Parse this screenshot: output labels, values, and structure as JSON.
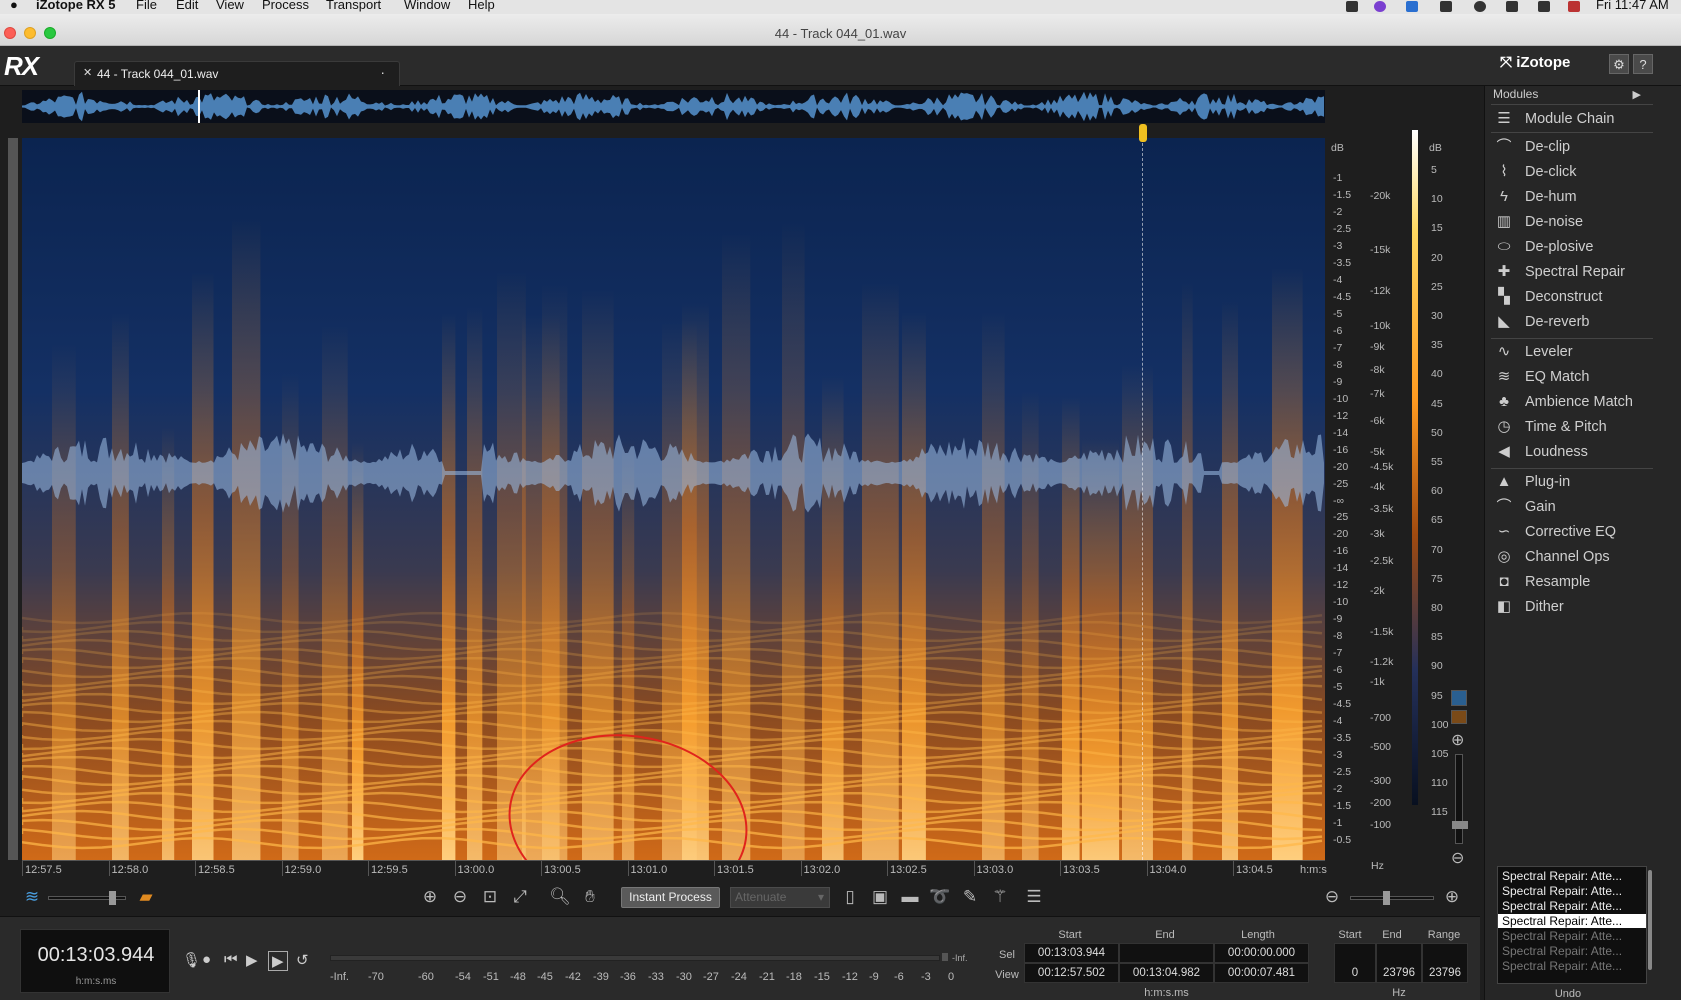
{
  "menubar": {
    "app_name": "iZotope RX 5",
    "items": [
      "File",
      "Edit",
      "View",
      "Process",
      "Transport",
      "Window",
      "Help"
    ],
    "clock": "Fri 11:47 AM"
  },
  "window": {
    "title": "44 - Track 044_01.wav"
  },
  "header": {
    "logo": "RX",
    "file_tab": "44 - Track 044_01.wav",
    "brand": "iZotope",
    "gear_label": "⚙",
    "help_label": "?"
  },
  "modules": {
    "header": "Modules",
    "chain": "Module Chain",
    "repair": [
      "De-clip",
      "De-click",
      "De-hum",
      "De-noise",
      "De-plosive",
      "Spectral Repair",
      "Deconstruct",
      "De-reverb"
    ],
    "mix": [
      "Leveler",
      "EQ Match",
      "Ambience Match",
      "Time & Pitch",
      "Loudness"
    ],
    "utility": [
      "Plug-in",
      "Gain",
      "Corrective EQ",
      "Channel Ops",
      "Resample",
      "Dither"
    ]
  },
  "time_axis": {
    "labels": [
      "12:57.5",
      "12:58.0",
      "12:58.5",
      "12:59.0",
      "12:59.5",
      "13:00.0",
      "13:00.5",
      "13:01.0",
      "13:01.5",
      "13:02.0",
      "13:02.5",
      "13:03.0",
      "13:03.5",
      "13:04.0",
      "13:04.5"
    ],
    "unit": "h:m:s"
  },
  "db_scale": {
    "unit": "dB",
    "top_labels": [
      "-1",
      "-1.5",
      "-2",
      "-2.5",
      "-3",
      "-3.5",
      "-4",
      "-4.5",
      "-5",
      "-6",
      "-7",
      "-8",
      "-9",
      "-10",
      "-12",
      "-14",
      "-16",
      "-20",
      "-25",
      "-∞",
      "-25",
      "-20",
      "-16",
      "-14",
      "-12",
      "-10",
      "-9",
      "-8",
      "-7",
      "-6",
      "-5",
      "-4.5",
      "-4",
      "-3.5",
      "-3",
      "-2.5",
      "-2",
      "-1.5",
      "-1",
      "-0.5"
    ]
  },
  "hz_scale": {
    "unit": "Hz",
    "labels": [
      "-20k",
      "-15k",
      "-12k",
      "-10k",
      "-9k",
      "-8k",
      "-7k",
      "-6k",
      "-5k",
      "-4.5k",
      "-4k",
      "-3.5k",
      "-3k",
      "-2.5k",
      "-2k",
      "-1.5k",
      "-1.2k",
      "-1k",
      "-700",
      "-500",
      "-300",
      "-200",
      "-100"
    ]
  },
  "color_scale": {
    "unit": "dB",
    "labels": [
      "5",
      "10",
      "15",
      "20",
      "25",
      "30",
      "35",
      "40",
      "45",
      "50",
      "55",
      "60",
      "65",
      "70",
      "75",
      "80",
      "85",
      "90",
      "95",
      "100",
      "105",
      "110",
      "115"
    ]
  },
  "toolbar": {
    "instant_process": "Instant Process",
    "attenuate": "Attenuate"
  },
  "transport": {
    "time": "00:13:03.944",
    "time_format": "h:m:s.ms",
    "meter_inf": "-Inf.",
    "meter_labels": [
      "-Inf.",
      "-70",
      "-60",
      "-54",
      "-51",
      "-48",
      "-45",
      "-42",
      "-39",
      "-36",
      "-33",
      "-30",
      "-27",
      "-24",
      "-21",
      "-18",
      "-15",
      "-12",
      "-9",
      "-6",
      "-3",
      "0"
    ]
  },
  "selection": {
    "headers": {
      "start": "Start",
      "end": "End",
      "length": "Length"
    },
    "sel_label": "Sel",
    "view_label": "View",
    "sel_start": "00:13:03.944",
    "sel_end": "",
    "sel_length": "00:00:00.000",
    "view_start": "00:12:57.502",
    "view_end": "00:13:04.982",
    "view_length": "00:00:07.481",
    "unit": "h:m:s.ms",
    "hz_headers": {
      "start": "Start",
      "end": "End",
      "range": "Range"
    },
    "hz_start": "0",
    "hz_end": "23796",
    "hz_range": "23796",
    "hz_unit": "Hz"
  },
  "undo": {
    "items": [
      "Spectral Repair: Atte...",
      "Spectral Repair: Atte...",
      "Spectral Repair: Atte...",
      "Spectral Repair: Atte...",
      "Spectral Repair: Atte...",
      "Spectral Repair: Atte...",
      "Spectral Repair: Atte..."
    ],
    "selected_index": 3,
    "label": "Undo"
  },
  "colors": {
    "spectrogram_low": "#081c3a",
    "spectrogram_high": "#ffa020",
    "waveform": "#7fa8d8",
    "annotation": "#e0241c",
    "playhead": "#f0c020"
  }
}
